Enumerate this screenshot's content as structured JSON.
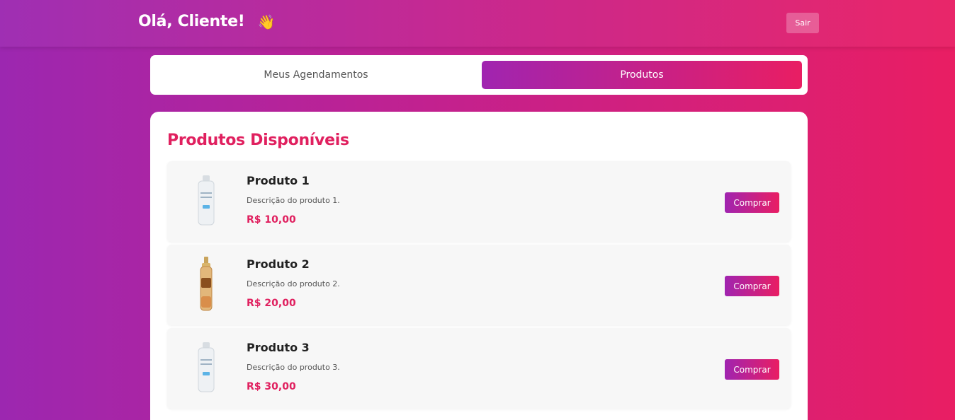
{
  "header": {
    "greeting": "Olá, Cliente!",
    "wave_icon": "👋",
    "logout_label": "Sair"
  },
  "tabs": [
    {
      "label": "Meus Agendamentos",
      "active": false
    },
    {
      "label": "Produtos",
      "active": true
    }
  ],
  "products_section": {
    "title": "Produtos Disponíveis",
    "buy_label": "Comprar",
    "items": [
      {
        "name": "Produto 1",
        "description": "Descrição do produto 1.",
        "price": "R$ 10,00",
        "image_icon": "white-bottle"
      },
      {
        "name": "Produto 2",
        "description": "Descrição do produto 2.",
        "price": "R$ 20,00",
        "image_icon": "gold-spray-bottle"
      },
      {
        "name": "Produto 3",
        "description": "Descrição do produto 3.",
        "price": "R$ 30,00",
        "image_icon": "white-bottle"
      }
    ]
  },
  "colors": {
    "gradient_start": "#9c27b0",
    "gradient_end": "#e91e63",
    "accent_text": "#e0205f"
  }
}
